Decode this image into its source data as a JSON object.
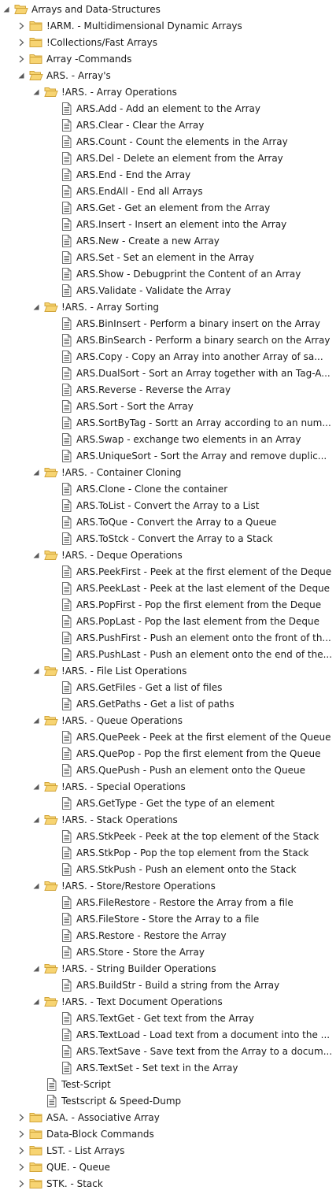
{
  "tree": [
    {
      "label": "Arrays and Data-Structures",
      "type": "folder",
      "state": "expanded",
      "level": 0
    },
    {
      "label": "!ARM. - Multidimensional Dynamic Arrays",
      "type": "folder",
      "state": "collapsed",
      "level": 1
    },
    {
      "label": "!Collections/Fast Arrays",
      "type": "folder",
      "state": "collapsed",
      "level": 1
    },
    {
      "label": "Array -Commands",
      "type": "folder",
      "state": "collapsed",
      "level": 1
    },
    {
      "label": "ARS. - Array's",
      "type": "folder",
      "state": "expanded",
      "level": 1
    },
    {
      "label": "!ARS. - Array Operations",
      "type": "folder",
      "state": "expanded",
      "level": 2
    },
    {
      "label": "ARS.Add - Add an element to the Array",
      "type": "doc",
      "level": 3
    },
    {
      "label": "ARS.Clear - Clear the Array",
      "type": "doc",
      "level": 3
    },
    {
      "label": "ARS.Count - Count the elements in the Array",
      "type": "doc",
      "level": 3
    },
    {
      "label": "ARS.Del - Delete an element from the Array",
      "type": "doc",
      "level": 3
    },
    {
      "label": "ARS.End - End the Array",
      "type": "doc",
      "level": 3
    },
    {
      "label": "ARS.EndAll - End all Arrays",
      "type": "doc",
      "level": 3
    },
    {
      "label": "ARS.Get - Get an element from the Array",
      "type": "doc",
      "level": 3
    },
    {
      "label": "ARS.Insert - Insert an element into the Array",
      "type": "doc",
      "level": 3
    },
    {
      "label": "ARS.New - Create a new Array",
      "type": "doc",
      "level": 3
    },
    {
      "label": "ARS.Set - Set an element in the Array",
      "type": "doc",
      "level": 3
    },
    {
      "label": "ARS.Show - Debugprint the Content of an Array",
      "type": "doc",
      "level": 3
    },
    {
      "label": "ARS.Validate - Validate the Array",
      "type": "doc",
      "level": 3
    },
    {
      "label": "!ARS. - Array Sorting",
      "type": "folder",
      "state": "expanded",
      "level": 2
    },
    {
      "label": "ARS.BinInsert - Perform a binary insert on the Array",
      "type": "doc",
      "level": 3
    },
    {
      "label": "ARS.BinSearch - Perform a binary search on the Array",
      "type": "doc",
      "level": 3
    },
    {
      "label": "ARS.Copy - Copy an Array into another Array of sa...",
      "type": "doc",
      "level": 3
    },
    {
      "label": "ARS.DualSort - Sort an Array together with an Tag-A...",
      "type": "doc",
      "level": 3
    },
    {
      "label": "ARS.Reverse - Reverse the Array",
      "type": "doc",
      "level": 3
    },
    {
      "label": "ARS.Sort - Sort the Array",
      "type": "doc",
      "level": 3
    },
    {
      "label": "ARS.SortByTag - Sortt an Array according to an num...",
      "type": "doc",
      "level": 3
    },
    {
      "label": "ARS.Swap - exchange two elements in an Array",
      "type": "doc",
      "level": 3
    },
    {
      "label": "ARS.UniqueSort - Sort the Array and remove duplic...",
      "type": "doc",
      "level": 3
    },
    {
      "label": "!ARS. - Container Cloning",
      "type": "folder",
      "state": "expanded",
      "level": 2
    },
    {
      "label": "ARS.Clone - Clone the container",
      "type": "doc",
      "level": 3
    },
    {
      "label": "ARS.ToList - Convert the Array to a List",
      "type": "doc",
      "level": 3
    },
    {
      "label": "ARS.ToQue - Convert the Array to a Queue",
      "type": "doc",
      "level": 3
    },
    {
      "label": "ARS.ToStck - Convert the Array to a Stack",
      "type": "doc",
      "level": 3
    },
    {
      "label": "!ARS. - Deque Operations",
      "type": "folder",
      "state": "expanded",
      "level": 2
    },
    {
      "label": "ARS.PeekFirst - Peek at the first element of the Deque",
      "type": "doc",
      "level": 3
    },
    {
      "label": "ARS.PeekLast - Peek at the last element of the Deque",
      "type": "doc",
      "level": 3
    },
    {
      "label": "ARS.PopFirst - Pop the first element from the Deque",
      "type": "doc",
      "level": 3
    },
    {
      "label": "ARS.PopLast - Pop the last element from the Deque",
      "type": "doc",
      "level": 3
    },
    {
      "label": "ARS.PushFirst - Push an element onto the front of th...",
      "type": "doc",
      "level": 3
    },
    {
      "label": "ARS.PushLast - Push an element onto the end of the...",
      "type": "doc",
      "level": 3
    },
    {
      "label": "!ARS. - File List Operations",
      "type": "folder",
      "state": "expanded",
      "level": 2
    },
    {
      "label": "ARS.GetFiles - Get a list of files",
      "type": "doc",
      "level": 3
    },
    {
      "label": "ARS.GetPaths - Get a list of paths",
      "type": "doc",
      "level": 3
    },
    {
      "label": "!ARS. - Queue Operations",
      "type": "folder",
      "state": "expanded",
      "level": 2
    },
    {
      "label": "ARS.QuePeek - Peek at the first element of the Queue",
      "type": "doc",
      "level": 3
    },
    {
      "label": "ARS.QuePop - Pop the first element from the Queue",
      "type": "doc",
      "level": 3
    },
    {
      "label": "ARS.QuePush - Push an element onto the Queue",
      "type": "doc",
      "level": 3
    },
    {
      "label": "!ARS. - Special Operations",
      "type": "folder",
      "state": "expanded",
      "level": 2
    },
    {
      "label": "ARS.GetType - Get the type of an element",
      "type": "doc",
      "level": 3
    },
    {
      "label": "!ARS. - Stack Operations",
      "type": "folder",
      "state": "expanded",
      "level": 2
    },
    {
      "label": "ARS.StkPeek - Peek at the top element of the Stack",
      "type": "doc",
      "level": 3
    },
    {
      "label": "ARS.StkPop - Pop the top element from the Stack",
      "type": "doc",
      "level": 3
    },
    {
      "label": "ARS.StkPush - Push an element onto the Stack",
      "type": "doc",
      "level": 3
    },
    {
      "label": "!ARS. - Store/Restore Operations",
      "type": "folder",
      "state": "expanded",
      "level": 2
    },
    {
      "label": "ARS.FileRestore - Restore the Array from a file",
      "type": "doc",
      "level": 3
    },
    {
      "label": "ARS.FileStore - Store the Array to a file",
      "type": "doc",
      "level": 3
    },
    {
      "label": "ARS.Restore - Restore the Array",
      "type": "doc",
      "level": 3
    },
    {
      "label": "ARS.Store - Store the Array",
      "type": "doc",
      "level": 3
    },
    {
      "label": "!ARS. - String Builder Operations",
      "type": "folder",
      "state": "expanded",
      "level": 2
    },
    {
      "label": "ARS.BuildStr - Build a string from the Array",
      "type": "doc",
      "level": 3
    },
    {
      "label": "!ARS. - Text Document Operations",
      "type": "folder",
      "state": "expanded",
      "level": 2
    },
    {
      "label": "ARS.TextGet - Get text from the Array",
      "type": "doc",
      "level": 3
    },
    {
      "label": "ARS.TextLoad - Load text from a document into the ...",
      "type": "doc",
      "level": 3
    },
    {
      "label": "ARS.TextSave - Save text from the Array to a docum...",
      "type": "doc",
      "level": 3
    },
    {
      "label": "ARS.TextSet - Set text in the Array",
      "type": "doc",
      "level": 3
    },
    {
      "label": "Test-Script",
      "type": "doc",
      "level": 2
    },
    {
      "label": "Testscript & Speed-Dump",
      "type": "doc",
      "level": 2
    },
    {
      "label": "ASA. - Associative Array",
      "type": "folder",
      "state": "collapsed",
      "level": 1
    },
    {
      "label": "Data-Block Commands",
      "type": "folder",
      "state": "collapsed",
      "level": 1
    },
    {
      "label": "LST. - List Arrays",
      "type": "folder",
      "state": "collapsed",
      "level": 1
    },
    {
      "label": "QUE. - Queue",
      "type": "folder",
      "state": "collapsed",
      "level": 1
    },
    {
      "label": "STK. - Stack",
      "type": "folder",
      "state": "collapsed",
      "level": 1
    }
  ],
  "colors": {
    "folder_fill": "#f7d472",
    "folder_stroke": "#d1a43a",
    "doc_stroke": "#6b6b6b",
    "twisty": "#595959",
    "hover_bg": "#e5f3fb"
  }
}
